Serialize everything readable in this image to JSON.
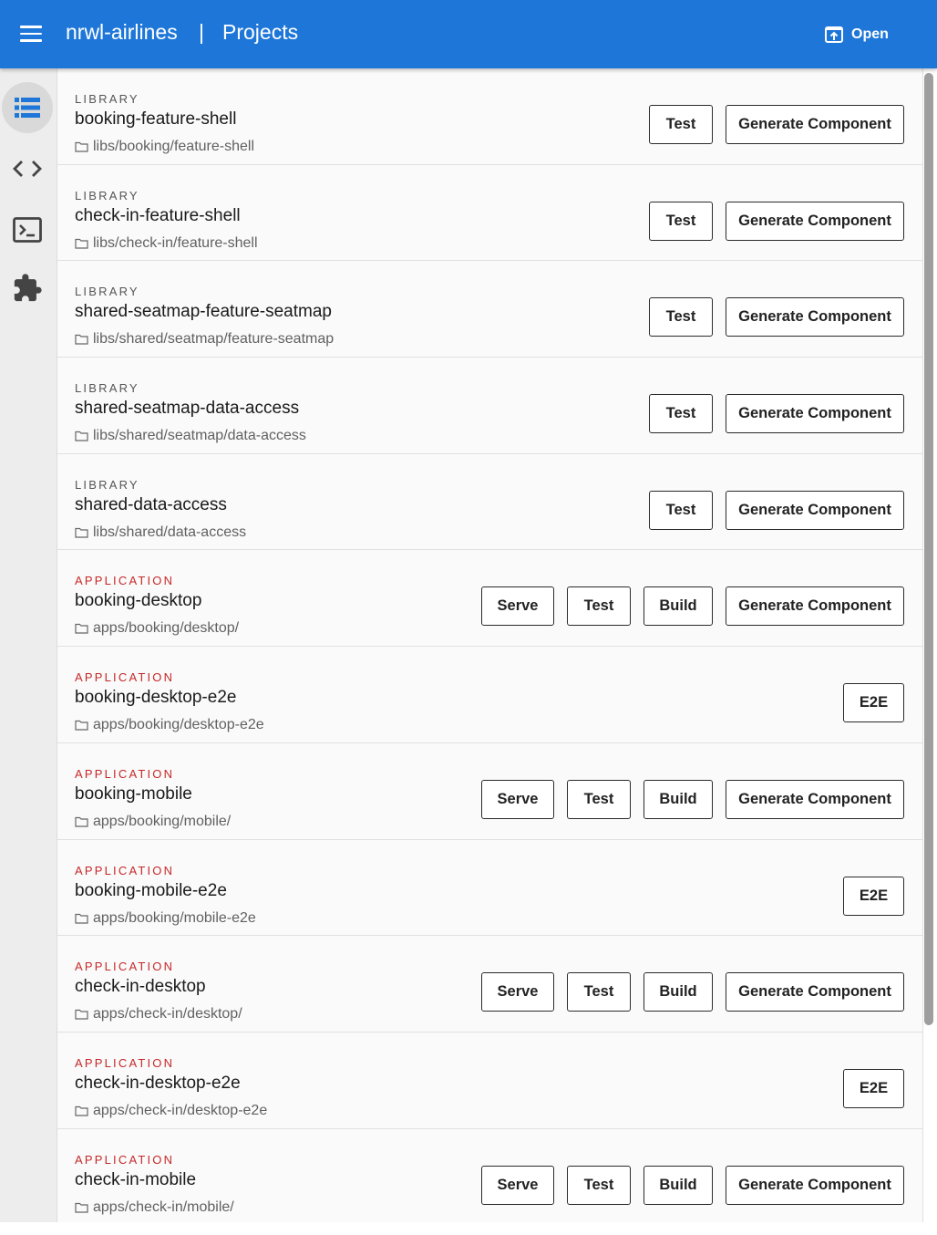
{
  "header": {
    "app_name": "nrwl-airlines",
    "separator": "|",
    "page_title": "Projects",
    "open_label": "Open"
  },
  "sidenav": {
    "items": [
      {
        "icon": "projects-list-icon",
        "active": true
      },
      {
        "icon": "code-icon",
        "active": false
      },
      {
        "icon": "terminal-icon",
        "active": false
      },
      {
        "icon": "extensions-puzzle-icon",
        "active": false
      }
    ]
  },
  "projects": [
    {
      "kind": "LIBRARY",
      "name": "booking-feature-shell",
      "path": "libs/booking/feature-shell",
      "actions": [
        "Test",
        "Generate Component"
      ]
    },
    {
      "kind": "LIBRARY",
      "name": "check-in-feature-shell",
      "path": "libs/check-in/feature-shell",
      "actions": [
        "Test",
        "Generate Component"
      ]
    },
    {
      "kind": "LIBRARY",
      "name": "shared-seatmap-feature-seatmap",
      "path": "libs/shared/seatmap/feature-seatmap",
      "actions": [
        "Test",
        "Generate Component"
      ]
    },
    {
      "kind": "LIBRARY",
      "name": "shared-seatmap-data-access",
      "path": "libs/shared/seatmap/data-access",
      "actions": [
        "Test",
        "Generate Component"
      ]
    },
    {
      "kind": "LIBRARY",
      "name": "shared-data-access",
      "path": "libs/shared/data-access",
      "actions": [
        "Test",
        "Generate Component"
      ]
    },
    {
      "kind": "APPLICATION",
      "name": "booking-desktop",
      "path": "apps/booking/desktop/",
      "actions": [
        "Serve",
        "Test",
        "Build",
        "Generate Component"
      ]
    },
    {
      "kind": "APPLICATION",
      "name": "booking-desktop-e2e",
      "path": "apps/booking/desktop-e2e",
      "actions": [
        "E2E"
      ]
    },
    {
      "kind": "APPLICATION",
      "name": "booking-mobile",
      "path": "apps/booking/mobile/",
      "actions": [
        "Serve",
        "Test",
        "Build",
        "Generate Component"
      ]
    },
    {
      "kind": "APPLICATION",
      "name": "booking-mobile-e2e",
      "path": "apps/booking/mobile-e2e",
      "actions": [
        "E2E"
      ]
    },
    {
      "kind": "APPLICATION",
      "name": "check-in-desktop",
      "path": "apps/check-in/desktop/",
      "actions": [
        "Serve",
        "Test",
        "Build",
        "Generate Component"
      ]
    },
    {
      "kind": "APPLICATION",
      "name": "check-in-desktop-e2e",
      "path": "apps/check-in/desktop-e2e",
      "actions": [
        "E2E"
      ]
    },
    {
      "kind": "APPLICATION",
      "name": "check-in-mobile",
      "path": "apps/check-in/mobile/",
      "actions": [
        "Serve",
        "Test",
        "Build",
        "Generate Component"
      ]
    }
  ],
  "colors": {
    "toolbar": "#1e77d8",
    "application_kind": "#c62828",
    "library_kind": "#555555"
  }
}
